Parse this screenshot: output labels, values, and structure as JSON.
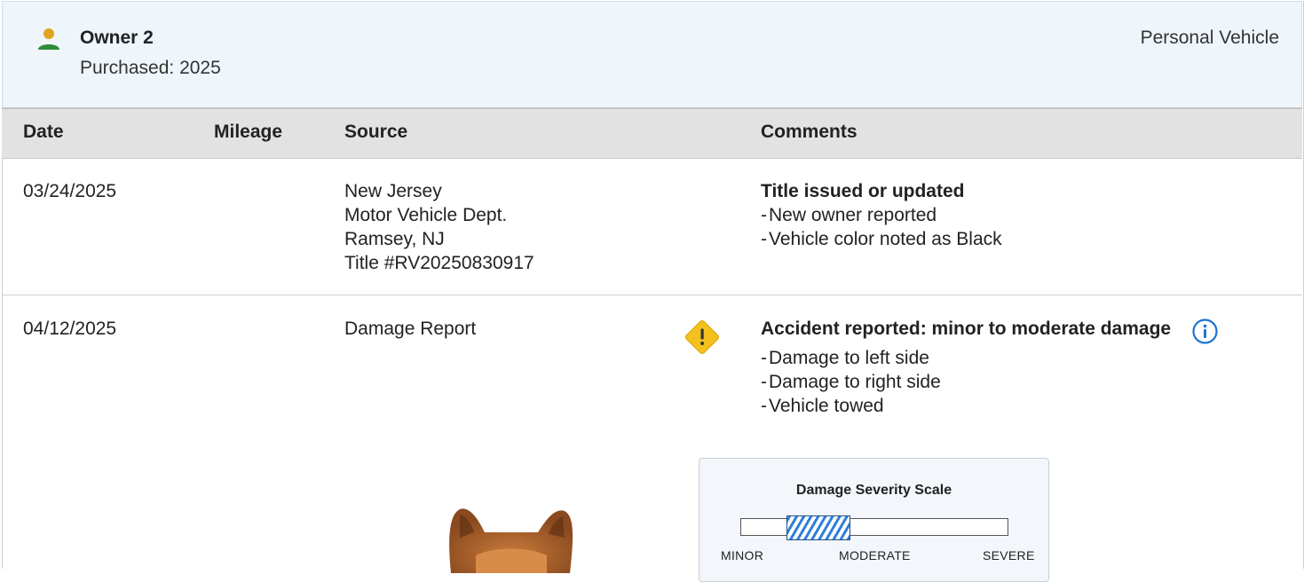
{
  "owner": {
    "name": "Owner 2",
    "purchased": "Purchased: 2025",
    "vehicle_type": "Personal Vehicle",
    "icon": "person-icon"
  },
  "table": {
    "headers": {
      "date": "Date",
      "mileage": "Mileage",
      "source": "Source",
      "comments": "Comments"
    },
    "rows": [
      {
        "date": "03/24/2025",
        "mileage": "",
        "source": [
          "New Jersey",
          "Motor Vehicle Dept.",
          "Ramsey, NJ",
          "Title #RV20250830917"
        ],
        "comment_title": "Title issued or updated",
        "comment_items": [
          "New owner reported",
          "Vehicle color noted as Black"
        ]
      },
      {
        "date": "04/12/2025",
        "mileage": "",
        "source": [
          "Damage Report"
        ],
        "comment_title": "Accident reported: minor to moderate damage",
        "comment_items": [
          "Damage to left side",
          "Damage to right side",
          "Vehicle towed"
        ],
        "alert_icon": "warning-icon",
        "info_icon": "info-icon"
      }
    ]
  },
  "severity": {
    "title": "Damage Severity Scale",
    "labels": {
      "minor": "MINOR",
      "moderate": "MODERATE",
      "severe": "SEVERE"
    },
    "range_start": 0.17,
    "range_end": 0.41,
    "fill_color": "#2f7fd8"
  },
  "colors": {
    "header_bg": "#eef5fb",
    "table_head_bg": "#e2e2e2",
    "warning": "#f3c01e",
    "info": "#1f74d1",
    "person_head": "#e0a31f",
    "person_body": "#2e8b3a"
  }
}
